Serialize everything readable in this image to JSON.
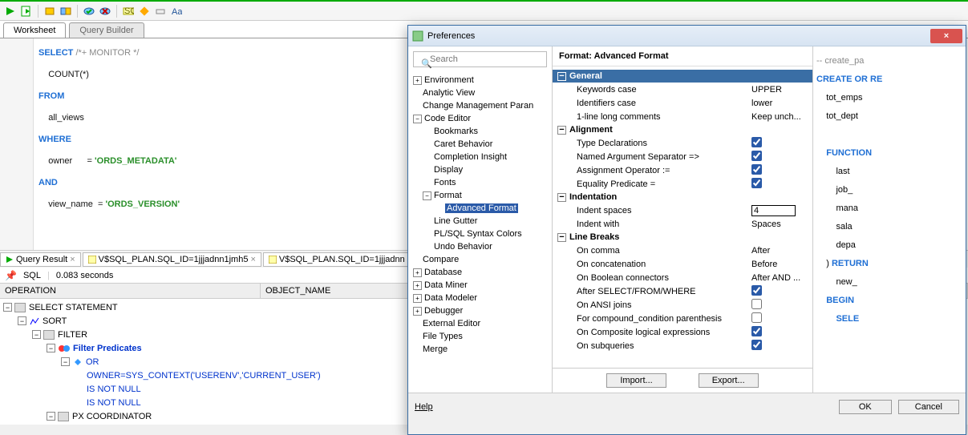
{
  "toolbar": {
    "icons": [
      "run-icon",
      "run-script-icon",
      "spacer",
      "refresh-icon",
      "db-icon",
      "spacer",
      "commit-icon",
      "rollback-icon",
      "spacer",
      "sql-icon",
      "pencil-icon",
      "eraser-icon",
      "font-icon"
    ]
  },
  "tabs": {
    "worksheet": "Worksheet",
    "builder": "Query Builder"
  },
  "code": {
    "l1a": "SELECT",
    "l1b": " /*+ MONITOR */",
    "l2": "    COUNT(*)",
    "l3": "FROM",
    "l4": "    all_views",
    "l5": "WHERE",
    "l6a": "    owner      = ",
    "l6b": "'ORDS_METADATA'",
    "l7": "AND",
    "l8a": "    view_name  = ",
    "l8b": "'ORDS_VERSION'"
  },
  "resultTabs": {
    "t1": "Query Result",
    "t2": "V$SQL_PLAN.SQL_ID=1jjjadnn1jmh5",
    "t3": "V$SQL_PLAN.SQL_ID=1jjjadnn"
  },
  "status": {
    "kind": "SQL",
    "time": "0.083 seconds"
  },
  "grid": {
    "col1": "OPERATION",
    "col2": "OBJECT_NAME"
  },
  "plan": {
    "r1": "SELECT STATEMENT",
    "r2": "SORT",
    "r3": "FILTER",
    "r4": "Filter Predicates",
    "r5": "OR",
    "r6": "OWNER=SYS_CONTEXT('USERENV','CURRENT_USER')",
    "r7": "IS NOT NULL",
    "r8": "IS NOT NULL",
    "r9": "PX COORDINATOR"
  },
  "dialog": {
    "title": "Preferences",
    "close": "×",
    "search_ph": "Search",
    "heading": "Format: Advanced Format",
    "tree": {
      "env": "Environment",
      "av": "Analytic View",
      "cmp": "Change Management Paran",
      "ce": "Code Editor",
      "bm": "Bookmarks",
      "cb": "Caret Behavior",
      "ci": "Completion Insight",
      "dp": "Display",
      "ft": "Fonts",
      "fm": "Format",
      "af": "Advanced Format",
      "lg": "Line Gutter",
      "sy": "PL/SQL Syntax Colors",
      "ub": "Undo Behavior",
      "cmp2": "Compare",
      "db": "Database",
      "dm": "Data Miner",
      "dmo": "Data Modeler",
      "dbg": "Debugger",
      "ee": "External Editor",
      "ft2": "File Types",
      "mg": "Merge"
    },
    "groups": {
      "gen": "General",
      "align": "Alignment",
      "indent": "Indentation",
      "lb": "Line Breaks"
    },
    "opts": {
      "kwcase": "Keywords case",
      "kwcase_v": "UPPER",
      "idcase": "Identifiers case",
      "idcase_v": "lower",
      "longc": "1-line long comments",
      "longc_v": "Keep unch...",
      "typed": "Type Declarations",
      "narg": "Named Argument Separator =>",
      "assn": "Assignment Operator :=",
      "eqp": "Equality Predicate =",
      "isp": "Indent spaces",
      "isp_v": "4",
      "iw": "Indent with",
      "iw_v": "Spaces",
      "oncm": "On comma",
      "oncm_v": "After",
      "oncat": "On concatenation",
      "oncat_v": "Before",
      "onbool": "On Boolean connectors",
      "onbool_v": "After AND ...",
      "asfw": "After SELECT/FROM/WHERE",
      "ansi": "On ANSI joins",
      "paren": "For compound_condition parenthesis",
      "comp": "On Composite logical expressions",
      "subq": "On subqueries"
    },
    "import": "Import...",
    "export": "Export...",
    "help": "Help",
    "ok": "OK",
    "cancel": "Cancel"
  },
  "preview": {
    "l1": "-- create_pa",
    "l2a": "CREATE ",
    "l2b": "OR",
    "l2c": " RE",
    "l3": "    tot_emps",
    "l4": "    tot_dept",
    "l5": "",
    "l6": "    FUNCTION",
    "l7": "        last",
    "l8": "        job_",
    "l9": "        mana",
    "l10": "        sala",
    "l11": "        depa",
    "l12a": "    ) ",
    "l12b": "RETURN",
    "l13": "        new_",
    "l14": "    BEGIN",
    "l15": "        SELE"
  }
}
